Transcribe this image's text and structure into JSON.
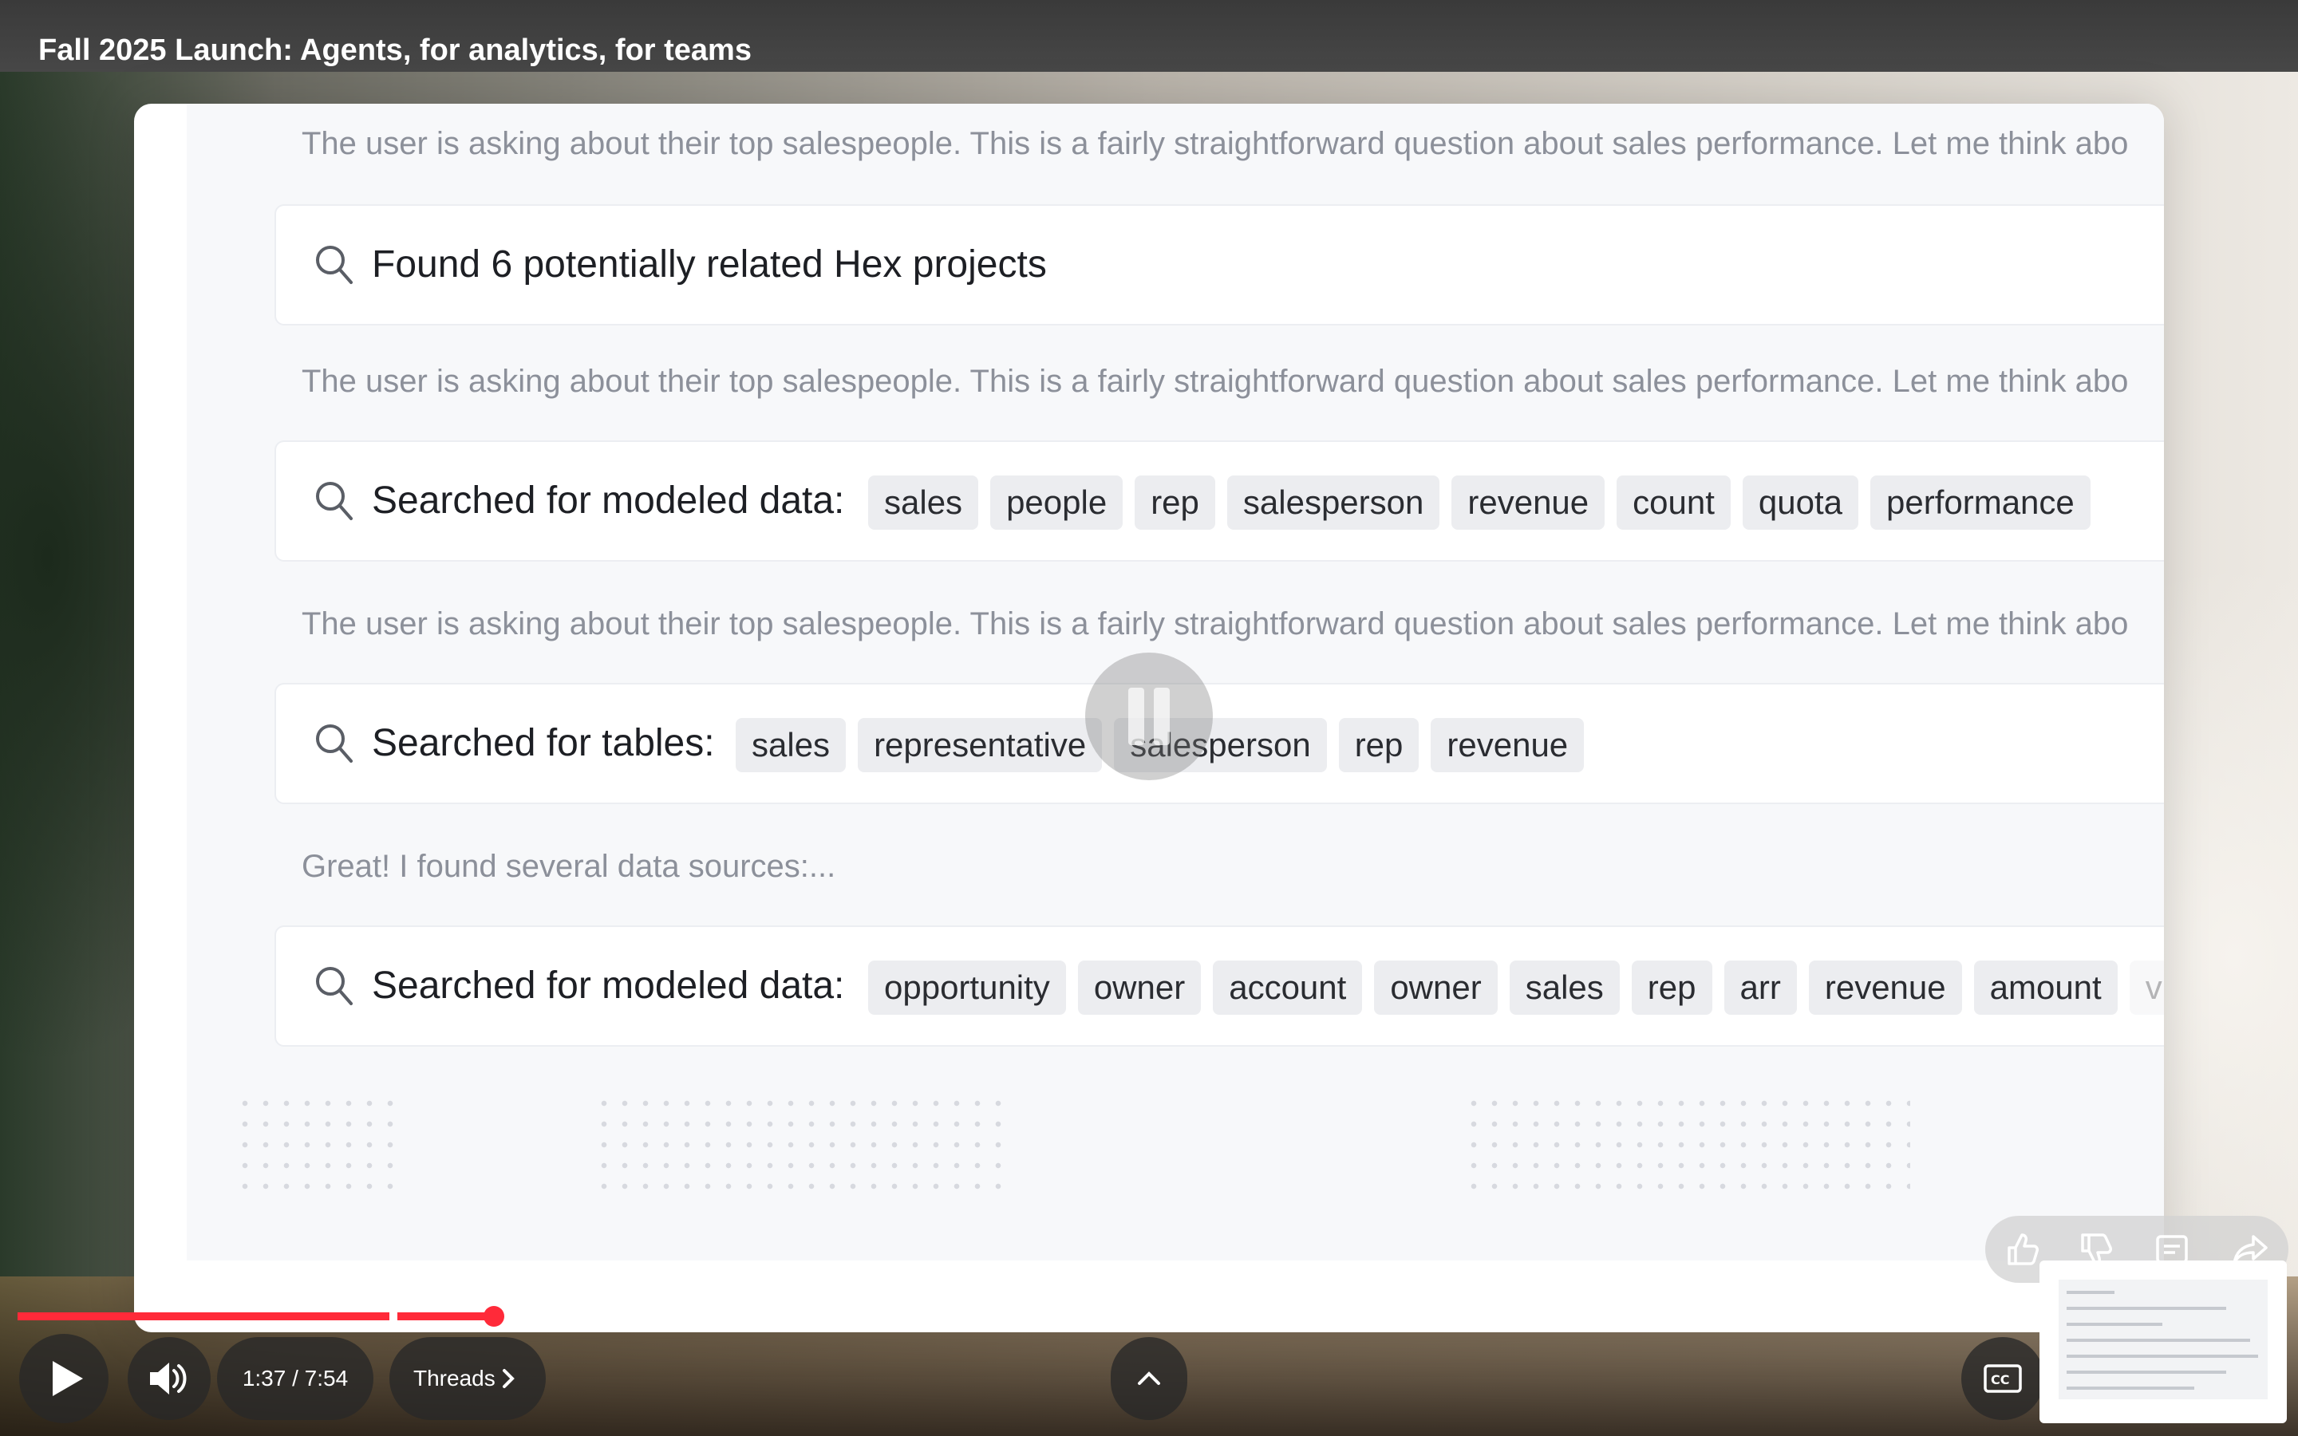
{
  "video": {
    "title": "Fall 2025 Launch: Agents, for analytics, for teams"
  },
  "content": {
    "thinking_1": "The user is asking about their top salespeople. This is a fairly straightforward question about sales performance. Let me think abo",
    "tool_1": {
      "label": "Found 6 potentially related Hex projects"
    },
    "thinking_2": "The user is asking about their top salespeople. This is a fairly straightforward question about sales performance. Let me think abo",
    "tool_2": {
      "label": "Searched for modeled data:",
      "tags": [
        "sales",
        "people",
        "rep",
        "salesperson",
        "revenue",
        "count",
        "quota",
        "performance"
      ],
      "trail": "1"
    },
    "thinking_3": "The user is asking about their top salespeople. This is a fairly straightforward question about sales performance. Let me think abo",
    "tool_3": {
      "label": "Searched for tables:",
      "tags": [
        "sales",
        "representative",
        "salesperson",
        "rep",
        "revenue"
      ]
    },
    "thinking_4": "Great! I found several data sources:...",
    "tool_4": {
      "label": "Searched for modeled data:",
      "tags": [
        "opportunity",
        "owner",
        "account",
        "owner",
        "sales",
        "rep",
        "arr",
        "revenue",
        "amount",
        "v"
      ],
      "trail": "1"
    }
  },
  "player": {
    "time_display": "1:37 / 7:54",
    "threads_label": "Threads",
    "played_fraction": 0.2,
    "accent_color": "#ff2a39"
  },
  "icons": {
    "search": "search-icon",
    "play": "play-icon",
    "volume": "volume-icon",
    "chevron_up": "chevron-up-icon",
    "chevron_right": "chevron-right-icon",
    "captions": "captions-icon",
    "like": "thumbs-up-icon",
    "dislike": "thumbs-down-icon",
    "save": "save-icon",
    "share": "share-icon",
    "pause": "pause-icon"
  }
}
